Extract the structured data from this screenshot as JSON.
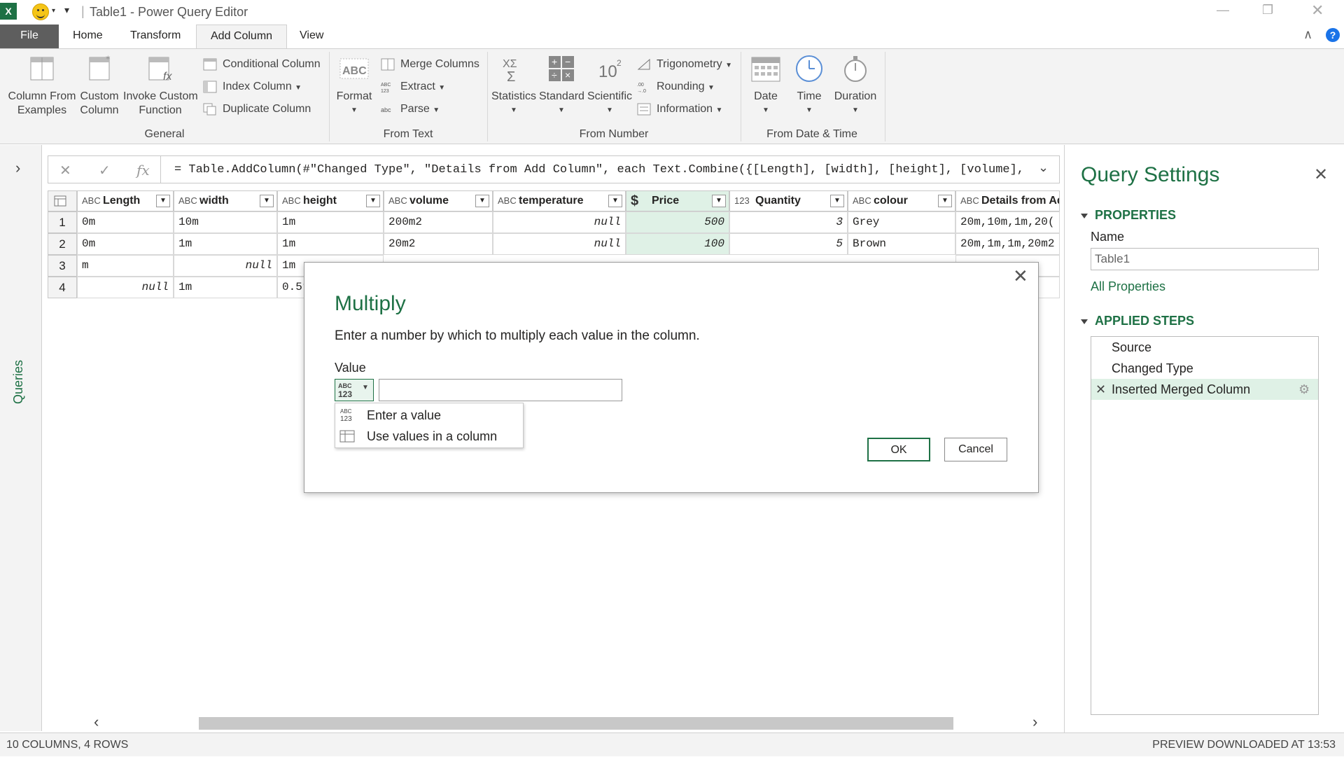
{
  "window": {
    "title": "Table1 - Power Query Editor",
    "separator": "|"
  },
  "tabs": [
    "File",
    "Home",
    "Transform",
    "Add Column",
    "View"
  ],
  "ribbon": {
    "general": {
      "column_from_examples": "Column From\nExamples",
      "custom_column": "Custom\nColumn",
      "invoke_custom_function": "Invoke Custom\nFunction",
      "conditional_column": "Conditional Column",
      "index_column": "Index Column",
      "duplicate_column": "Duplicate Column",
      "group_label": "General"
    },
    "from_text": {
      "format": "Format",
      "merge_columns": "Merge Columns",
      "extract": "Extract",
      "parse": "Parse",
      "group_label": "From Text"
    },
    "from_number": {
      "statistics": "Statistics",
      "standard": "Standard",
      "scientific": "Scientific",
      "trigonometry": "Trigonometry",
      "rounding": "Rounding",
      "information": "Information",
      "group_label": "From Number"
    },
    "from_date_time": {
      "date": "Date",
      "time": "Time",
      "duration": "Duration",
      "group_label": "From Date & Time"
    }
  },
  "left_pane": {
    "label": "Queries"
  },
  "formula": "= Table.AddColumn(#\"Changed Type\", \"Details from Add Column\", each Text.Combine({[Length], [width], [height], [volume],",
  "grid": {
    "headers": [
      {
        "type": "ABC",
        "name": "Length"
      },
      {
        "type": "ABC",
        "name": "width"
      },
      {
        "type": "ABC",
        "name": "height"
      },
      {
        "type": "ABC",
        "name": "volume"
      },
      {
        "type": "ABC",
        "name": "temperature"
      },
      {
        "type": "$",
        "name": "Price"
      },
      {
        "type": "123",
        "name": "Quantity"
      },
      {
        "type": "ABC",
        "name": "colour"
      },
      {
        "type": "ABC",
        "name": "Details from Ad"
      }
    ],
    "rows": [
      {
        "num": "1",
        "cells": [
          "0m",
          "10m",
          "1m",
          "200m2",
          "null",
          "500",
          "3",
          "Grey",
          "20m,10m,1m,20("
        ]
      },
      {
        "num": "2",
        "cells": [
          "0m",
          "1m",
          "1m",
          "20m2",
          "null",
          "100",
          "5",
          "Brown",
          "20m,1m,1m,20m2"
        ]
      },
      {
        "num": "3",
        "cells": [
          "m",
          "null",
          "1m",
          "",
          "",
          "",
          "",
          "",
          "rey"
        ]
      },
      {
        "num": "4",
        "cells": [
          "null",
          "1m",
          "0.5r",
          "",
          "",
          "",
          "",
          "",
          "c,:"
        ]
      }
    ]
  },
  "query_settings": {
    "title": "Query Settings",
    "properties_label": "PROPERTIES",
    "name_label": "Name",
    "name_value": "Table1",
    "all_properties": "All Properties",
    "applied_steps_label": "APPLIED STEPS",
    "steps": [
      "Source",
      "Changed Type",
      "Inserted Merged Column"
    ]
  },
  "status": {
    "left": "10 COLUMNS, 4 ROWS",
    "right": "PREVIEW DOWNLOADED AT 13:53"
  },
  "dialog": {
    "title": "Multiply",
    "description": "Enter a number by which to multiply each value in the column.",
    "value_label": "Value",
    "value": "",
    "menu": [
      "Enter a value",
      "Use values in a column"
    ],
    "ok": "OK",
    "cancel": "Cancel"
  }
}
